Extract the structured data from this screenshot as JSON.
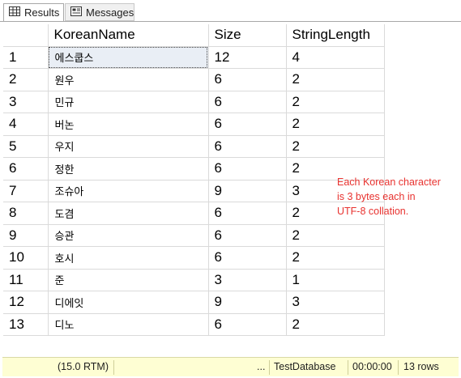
{
  "tabs": [
    {
      "label": "Results",
      "icon": "grid-icon"
    },
    {
      "label": "Messages",
      "icon": "messages-icon"
    }
  ],
  "grid": {
    "columns": [
      "KoreanName",
      "Size",
      "StringLength"
    ],
    "rows": [
      {
        "n": "1",
        "name": "에스쿱스",
        "size": "12",
        "len": "4"
      },
      {
        "n": "2",
        "name": "원우",
        "size": "6",
        "len": "2"
      },
      {
        "n": "3",
        "name": "민규",
        "size": "6",
        "len": "2"
      },
      {
        "n": "4",
        "name": "버논",
        "size": "6",
        "len": "2"
      },
      {
        "n": "5",
        "name": "우지",
        "size": "6",
        "len": "2"
      },
      {
        "n": "6",
        "name": "정한",
        "size": "6",
        "len": "2"
      },
      {
        "n": "7",
        "name": "조슈아",
        "size": "9",
        "len": "3"
      },
      {
        "n": "8",
        "name": "도겸",
        "size": "6",
        "len": "2"
      },
      {
        "n": "9",
        "name": "승관",
        "size": "6",
        "len": "2"
      },
      {
        "n": "10",
        "name": "호시",
        "size": "6",
        "len": "2"
      },
      {
        "n": "11",
        "name": "준",
        "size": "3",
        "len": "1"
      },
      {
        "n": "12",
        "name": "디에잇",
        "size": "9",
        "len": "3"
      },
      {
        "n": "13",
        "name": "디노",
        "size": "6",
        "len": "2"
      }
    ]
  },
  "annotation": {
    "line1": "Each Korean character",
    "line2": "is 3 bytes each in",
    "line3": "UTF-8 collation."
  },
  "status": {
    "version": "(15.0 RTM)",
    "ellipsis": "...",
    "database": "TestDatabase",
    "elapsed": "00:00:00",
    "rows": "13 rows"
  },
  "colors": {
    "annotation": "#e8322f",
    "statusbar_bg": "#fefed3",
    "selected_cell_bg": "#e9eef5"
  }
}
